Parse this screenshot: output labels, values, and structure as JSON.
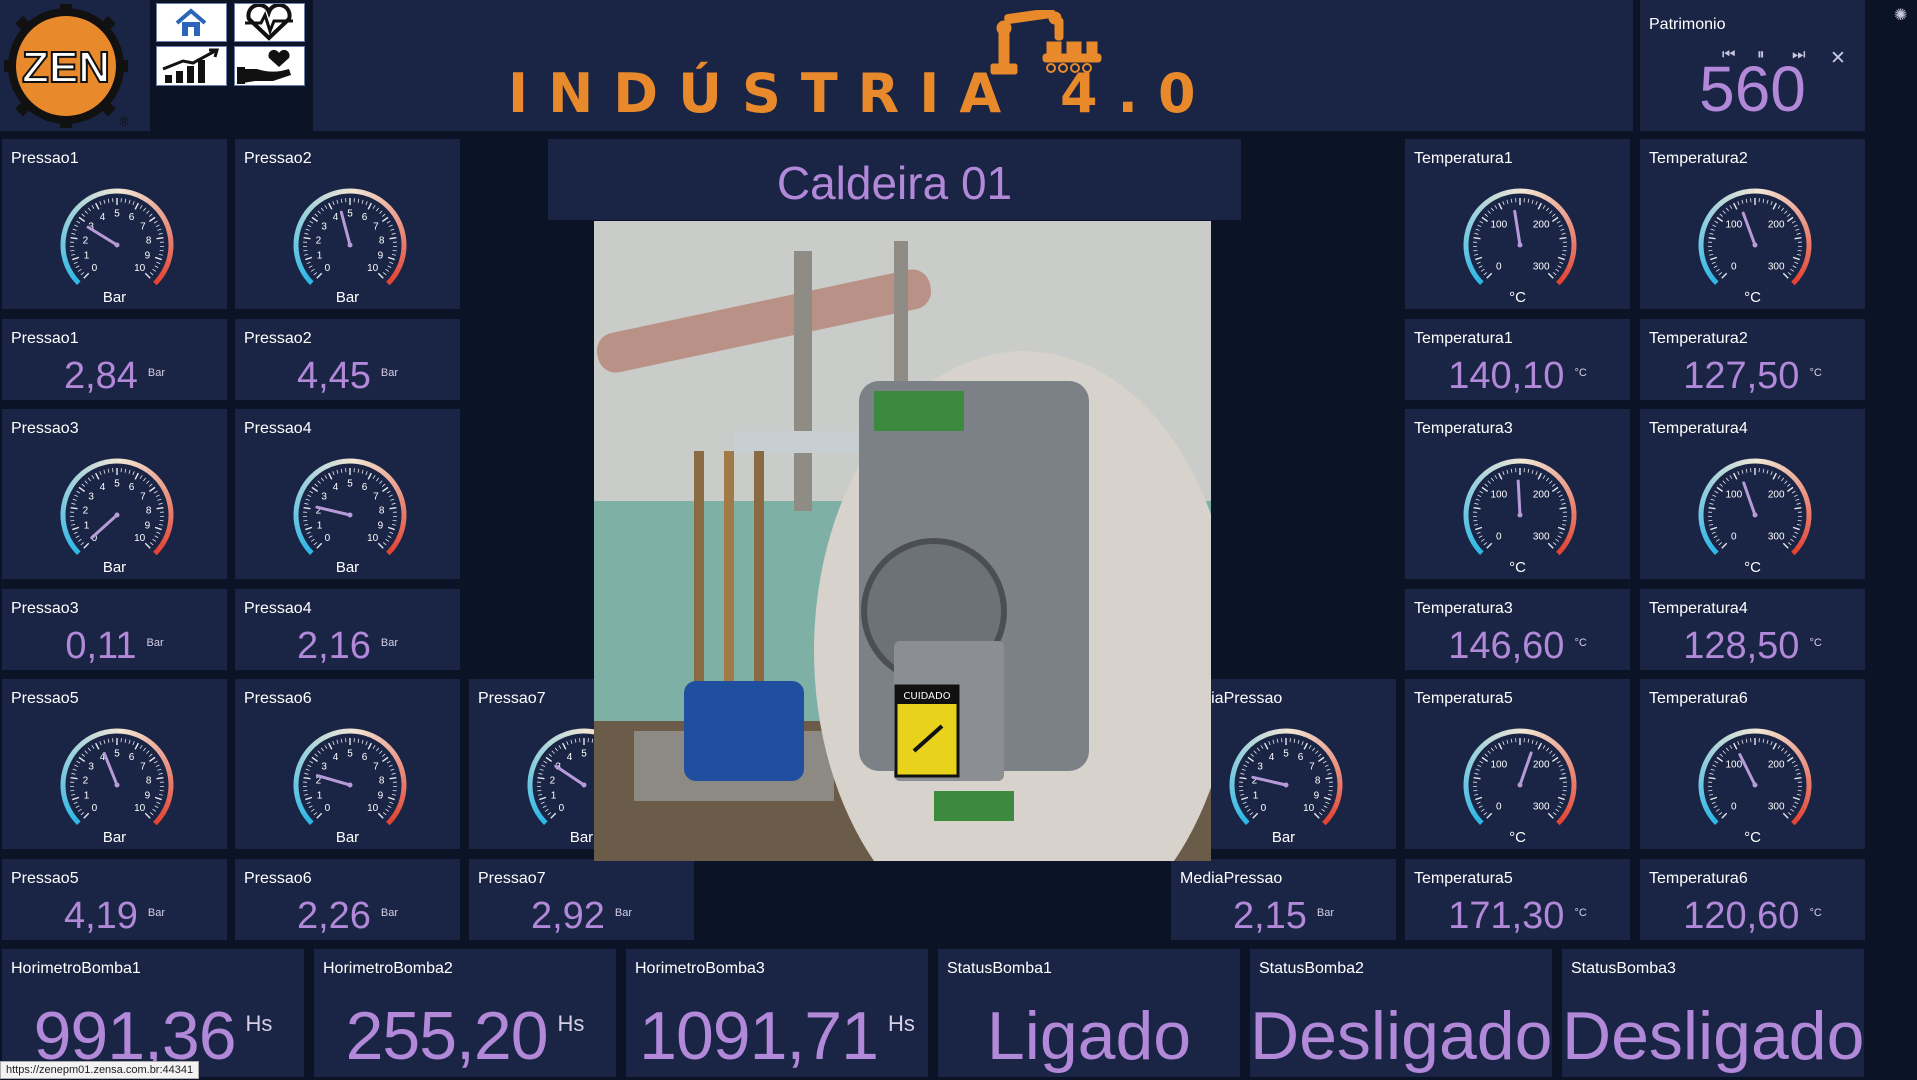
{
  "header": {
    "logo_text": "ZEN",
    "banner_title": "INDÚSTRIA 4.0",
    "patrimonio": {
      "label": "Patrimonio",
      "value": "560"
    }
  },
  "center": {
    "title": "Caldeira 01"
  },
  "pressure_gauges": [
    {
      "label": "Pressao1",
      "value": 2.84,
      "unit": "Bar"
    },
    {
      "label": "Pressao2",
      "value": 4.45,
      "unit": "Bar"
    },
    {
      "label": "Pressao3",
      "value": 0.11,
      "unit": "Bar"
    },
    {
      "label": "Pressao4",
      "value": 2.16,
      "unit": "Bar"
    },
    {
      "label": "Pressao5",
      "value": 4.19,
      "unit": "Bar"
    },
    {
      "label": "Pressao6",
      "value": 2.26,
      "unit": "Bar"
    },
    {
      "label": "Pressao7",
      "value": 2.92,
      "unit": "Bar"
    },
    {
      "label": "MediaPressao",
      "value": 2.15,
      "unit": "Bar"
    }
  ],
  "pressure_values": [
    {
      "label": "Pressao1",
      "value": "2,84",
      "unit": "Bar"
    },
    {
      "label": "Pressao2",
      "value": "4,45",
      "unit": "Bar"
    },
    {
      "label": "Pressao3",
      "value": "0,11",
      "unit": "Bar"
    },
    {
      "label": "Pressao4",
      "value": "2,16",
      "unit": "Bar"
    },
    {
      "label": "Pressao5",
      "value": "4,19",
      "unit": "Bar"
    },
    {
      "label": "Pressao6",
      "value": "2,26",
      "unit": "Bar"
    },
    {
      "label": "Pressao7",
      "value": "2,92",
      "unit": "Bar"
    },
    {
      "label": "MediaPressao",
      "value": "2,15",
      "unit": "Bar"
    }
  ],
  "pressure_scale": {
    "min": 0,
    "max": 10,
    "ticks": [
      "0",
      "1",
      "2",
      "3",
      "4",
      "5",
      "6",
      "7",
      "8",
      "9",
      "10"
    ]
  },
  "temperature_gauges": [
    {
      "label": "Temperatura1",
      "value": 140.1,
      "unit": "°C"
    },
    {
      "label": "Temperatura2",
      "value": 127.5,
      "unit": "°C"
    },
    {
      "label": "Temperatura3",
      "value": 146.6,
      "unit": "°C"
    },
    {
      "label": "Temperatura4",
      "value": 128.5,
      "unit": "°C"
    },
    {
      "label": "Temperatura5",
      "value": 171.3,
      "unit": "°C"
    },
    {
      "label": "Temperatura6",
      "value": 120.6,
      "unit": "°C"
    }
  ],
  "temperature_values": [
    {
      "label": "Temperatura1",
      "value": "140,10",
      "unit": "°C"
    },
    {
      "label": "Temperatura2",
      "value": "127,50",
      "unit": "°C"
    },
    {
      "label": "Temperatura3",
      "value": "146,60",
      "unit": "°C"
    },
    {
      "label": "Temperatura4",
      "value": "128,50",
      "unit": "°C"
    },
    {
      "label": "Temperatura5",
      "value": "171,30",
      "unit": "°C"
    },
    {
      "label": "Temperatura6",
      "value": "120,60",
      "unit": "°C"
    }
  ],
  "temperature_scale": {
    "min": 0,
    "max": 300,
    "ticks": [
      "0",
      "100",
      "200",
      "300"
    ]
  },
  "horimetros": [
    {
      "label": "HorimetroBomba1",
      "value": "991,36",
      "unit": "Hs"
    },
    {
      "label": "HorimetroBomba2",
      "value": "255,20",
      "unit": "Hs"
    },
    {
      "label": "HorimetroBomba3",
      "value": "1091,71",
      "unit": "Hs"
    }
  ],
  "statuses": [
    {
      "label": "StatusBomba1",
      "value": "Ligado"
    },
    {
      "label": "StatusBomba2",
      "value": "Desligado"
    },
    {
      "label": "StatusBomba3",
      "value": "Desligado"
    }
  ],
  "status_bar": {
    "url": "https://zenepm01.zensa.com.br:44341"
  },
  "colors": {
    "background": "#0b1426",
    "tile": "#1a2444",
    "value": "#b289d9",
    "accent_orange": "#e8892b",
    "gauge_cold": "#2fb8e6",
    "gauge_hot": "#e23b2a"
  }
}
